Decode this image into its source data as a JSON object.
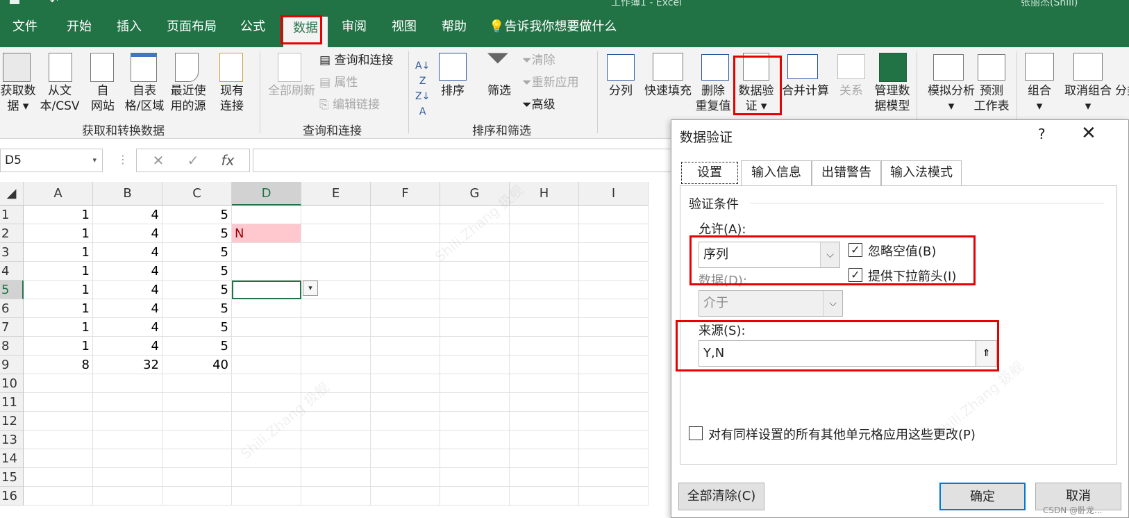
{
  "ribbon_tabs": [
    "文件",
    "开始",
    "插入",
    "页面布局",
    "公式",
    "数据",
    "审阅",
    "视图",
    "帮助"
  ],
  "tell_me": "告诉我你想要做什么",
  "ribbon": {
    "get_data": "获取数",
    "get_data2": "据",
    "from_text": "从文",
    "from_text2": "本/CSV",
    "from_web": "自",
    "from_web2": "网站",
    "from_table": "自表",
    "from_table2": "格/区域",
    "recent": "最近使",
    "recent2": "用的源",
    "existing": "现有",
    "existing2": "连接",
    "group_get": "获取和转换数据",
    "refresh_all": "全部刷新",
    "queries": "查询和连接",
    "properties": "属性",
    "edit_links": "编辑链接",
    "group_queries": "查询和连接",
    "sort": "排序",
    "filter": "筛选",
    "clear": "清除",
    "reapply": "重新应用",
    "advanced": "高级",
    "group_sort": "排序和筛选",
    "text_to_cols": "分列",
    "flash_fill": "快速填充",
    "remove_dup": "删除",
    "remove_dup2": "重复值",
    "data_val": "数据验",
    "data_val2": "证",
    "consolidate": "合并计算",
    "relations": "关系",
    "manage_model": "管理数",
    "manage_model2": "据模型",
    "what_if": "模拟分析",
    "forecast": "预测",
    "forecast2": "工作表",
    "group": "组合",
    "ungroup": "取消组合",
    "subtotal": "分类"
  },
  "name_box": "D5",
  "columns": [
    "A",
    "B",
    "C",
    "D",
    "E",
    "F",
    "G",
    "H",
    "I"
  ],
  "rows": [
    "1",
    "2",
    "3",
    "4",
    "5",
    "6",
    "7",
    "8",
    "9",
    "10",
    "11",
    "12",
    "13",
    "14",
    "15",
    "16"
  ],
  "cells": {
    "A": [
      "1",
      "1",
      "1",
      "1",
      "1",
      "1",
      "1",
      "1",
      "8"
    ],
    "B": [
      "4",
      "4",
      "4",
      "4",
      "4",
      "4",
      "4",
      "4",
      "32"
    ],
    "C": [
      "5",
      "5",
      "5",
      "5",
      "5",
      "5",
      "5",
      "5",
      "40"
    ],
    "D2": "N"
  },
  "dialog": {
    "title": "数据验证",
    "help": "?",
    "close": "✕",
    "tabs": [
      "设置",
      "输入信息",
      "出错警告",
      "输入法模式"
    ],
    "section": "验证条件",
    "allow_label": "允许(A):",
    "allow_value": "序列",
    "ignore_blank": "忽略空值(B)",
    "dropdown": "提供下拉箭头(I)",
    "data_label": "数据(D):",
    "data_value": "介于",
    "source_label": "来源(S):",
    "source_value": "Y,N",
    "apply_all": "对有同样设置的所有其他单元格应用这些更改(P)",
    "clear_all": "全部清除(C)",
    "ok": "确定",
    "cancel": "取消"
  },
  "watermark": "Shili.Zhang  扱舰",
  "csdn": "CSDN @卧龙...",
  "accent": "#217346",
  "highlight_red": "#e60000"
}
